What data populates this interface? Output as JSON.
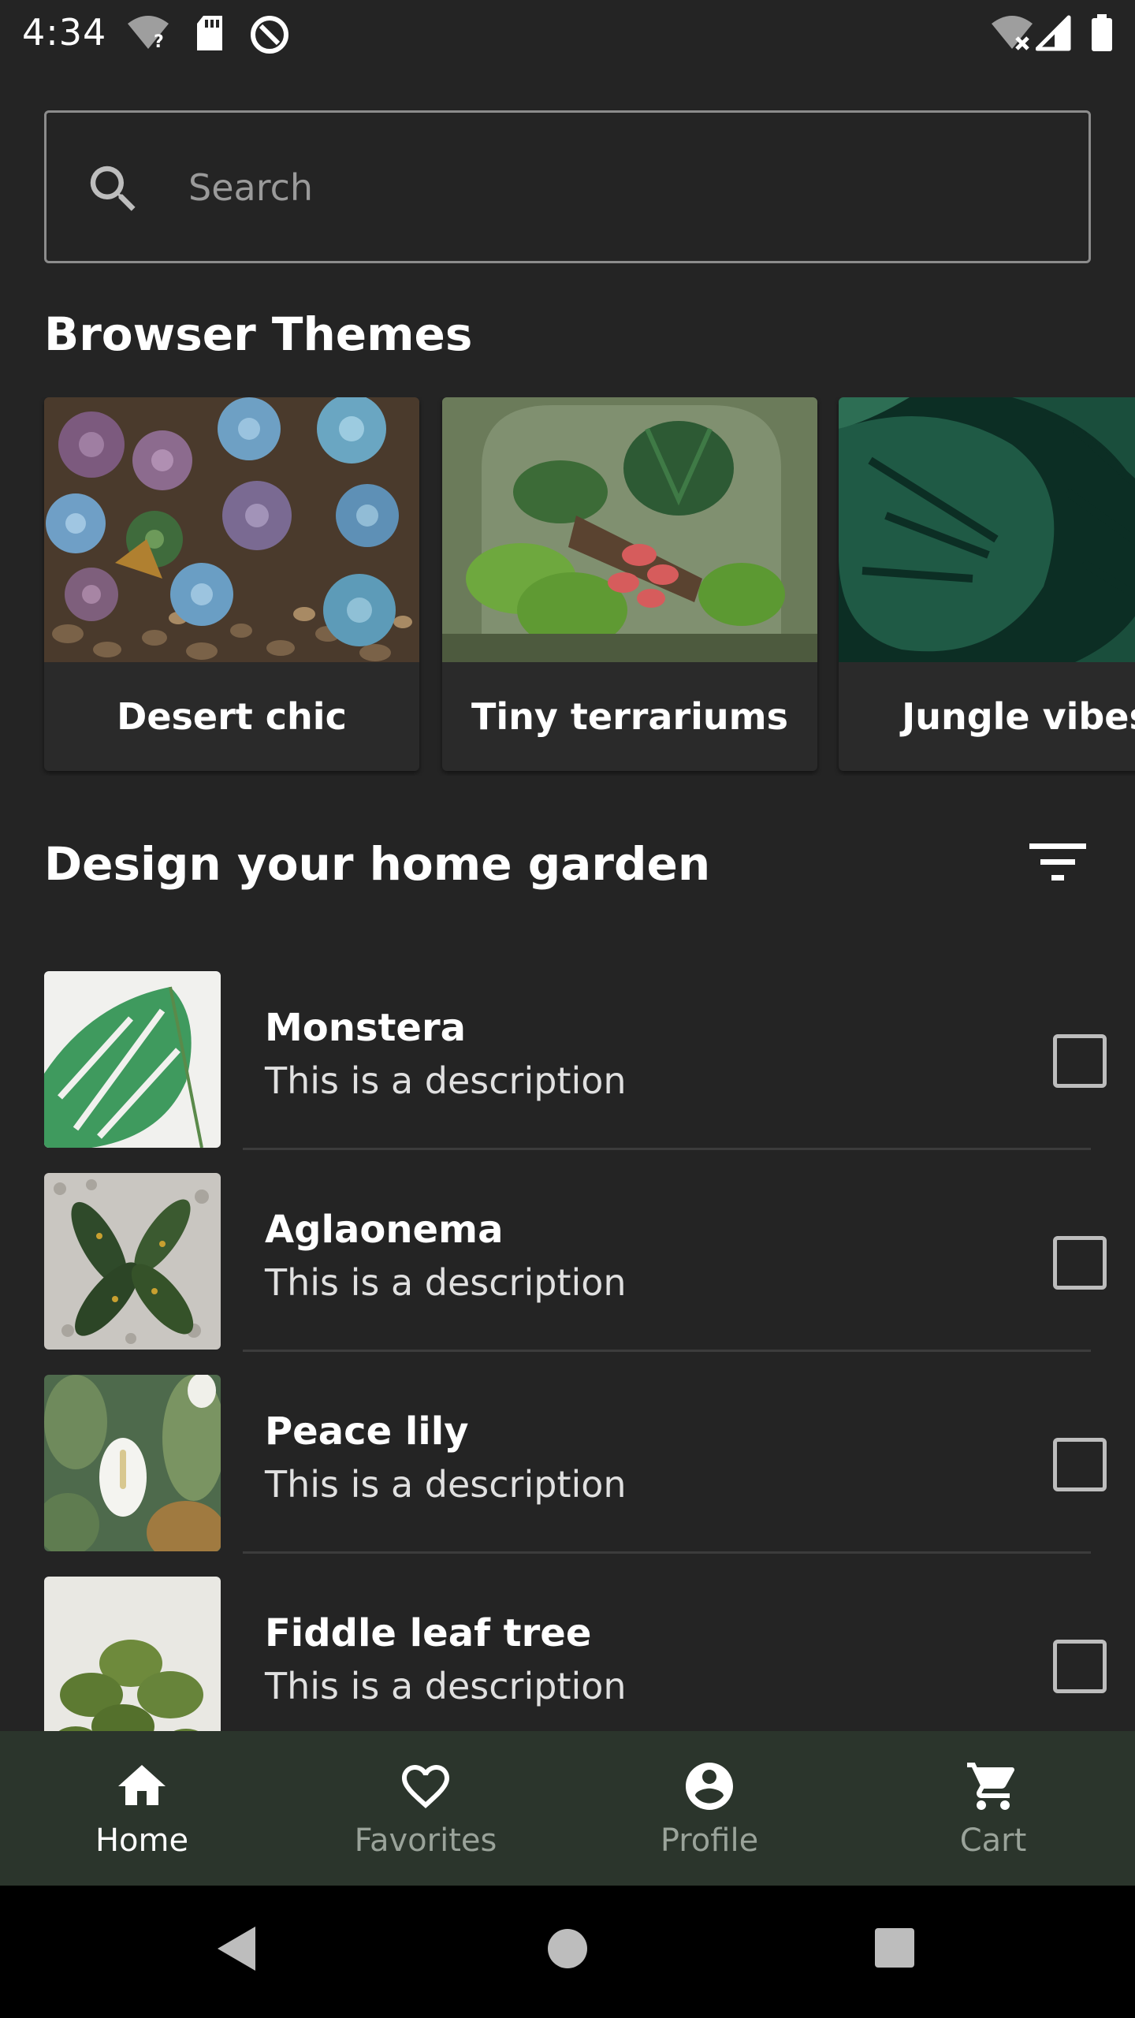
{
  "status_bar": {
    "time": "4:34",
    "icons": [
      "wifi-question-icon",
      "sd-card-icon",
      "data-saver-icon",
      "wifi-off-icon",
      "cell-signal-icon",
      "battery-icon"
    ]
  },
  "search": {
    "placeholder": "Search",
    "value": ""
  },
  "themes": {
    "title": "Browser Themes",
    "cards": [
      {
        "label": "Desert chic"
      },
      {
        "label": "Tiny terrariums"
      },
      {
        "label": "Jungle vibes"
      }
    ]
  },
  "garden": {
    "title": "Design your home garden",
    "plants": [
      {
        "name": "Monstera",
        "description": "This is a description",
        "checked": false
      },
      {
        "name": "Aglaonema",
        "description": "This is a description",
        "checked": false
      },
      {
        "name": "Peace lily",
        "description": "This is a description",
        "checked": false
      },
      {
        "name": "Fiddle leaf tree",
        "description": "This is a description",
        "checked": false
      }
    ]
  },
  "bottom_nav": {
    "items": [
      {
        "label": "Home",
        "icon": "home-icon",
        "active": true
      },
      {
        "label": "Favorites",
        "icon": "heart-icon",
        "active": false
      },
      {
        "label": "Profile",
        "icon": "account-circle-icon",
        "active": false
      },
      {
        "label": "Cart",
        "icon": "cart-icon",
        "active": false
      }
    ]
  },
  "colors": {
    "background": "#242424",
    "bottom_nav_background": "#2b352c",
    "nav_inactive": "#9aa39a",
    "divider": "#3c3c3c"
  }
}
